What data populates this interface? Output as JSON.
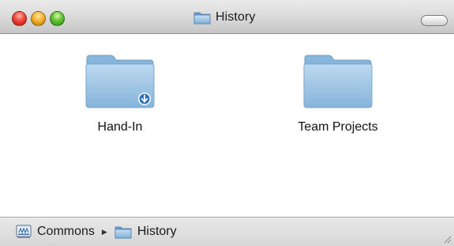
{
  "window": {
    "title": "History",
    "title_icon": "folder-icon"
  },
  "content": {
    "items": [
      {
        "label": "Hand-In",
        "icon": "drop-box-folder-icon"
      },
      {
        "label": "Team Projects",
        "icon": "folder-icon"
      }
    ]
  },
  "pathbar": {
    "items": [
      {
        "label": "Commons",
        "icon": "server-volume-icon"
      },
      {
        "label": "History",
        "icon": "folder-icon"
      }
    ],
    "separator_icon": "triangle-right-icon"
  },
  "colors": {
    "folder_blue": "#9cc3e2",
    "close_red": "#f0463a",
    "minimize_yellow": "#f5b12e",
    "zoom_green": "#5fc233"
  }
}
